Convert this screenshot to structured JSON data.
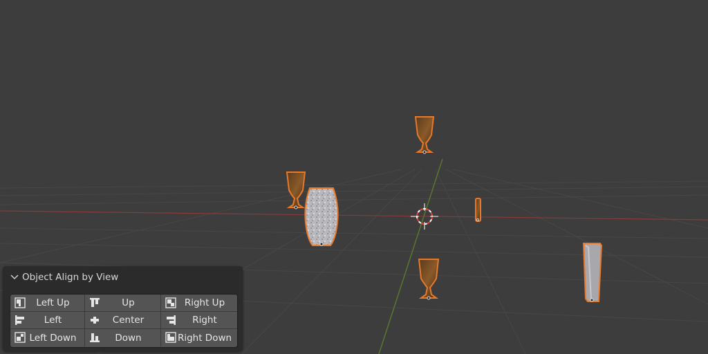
{
  "viewport": {
    "background": "#3d3d3d",
    "objects": [
      {
        "name": "goblet",
        "material": "wood"
      },
      {
        "name": "goblet",
        "material": "wood"
      },
      {
        "name": "goblet",
        "material": "wood"
      },
      {
        "name": "vase",
        "material": "marble"
      },
      {
        "name": "small-bar",
        "material": "wood"
      },
      {
        "name": "tall-block",
        "material": "grey"
      }
    ],
    "selection_color": "#e8792a"
  },
  "panel": {
    "title": "Object Align by View",
    "expanded": true,
    "buttons": [
      {
        "label": "Left Up",
        "icon": "align-left-up-icon"
      },
      {
        "label": "Up",
        "icon": "align-up-icon"
      },
      {
        "label": "Right Up",
        "icon": "align-right-up-icon"
      },
      {
        "label": "Left",
        "icon": "align-left-icon"
      },
      {
        "label": "Center",
        "icon": "align-center-icon"
      },
      {
        "label": "Right",
        "icon": "align-right-icon"
      },
      {
        "label": "Left Down",
        "icon": "align-left-down-icon"
      },
      {
        "label": "Down",
        "icon": "align-down-icon"
      },
      {
        "label": "Right Down",
        "icon": "align-right-down-icon"
      }
    ]
  }
}
